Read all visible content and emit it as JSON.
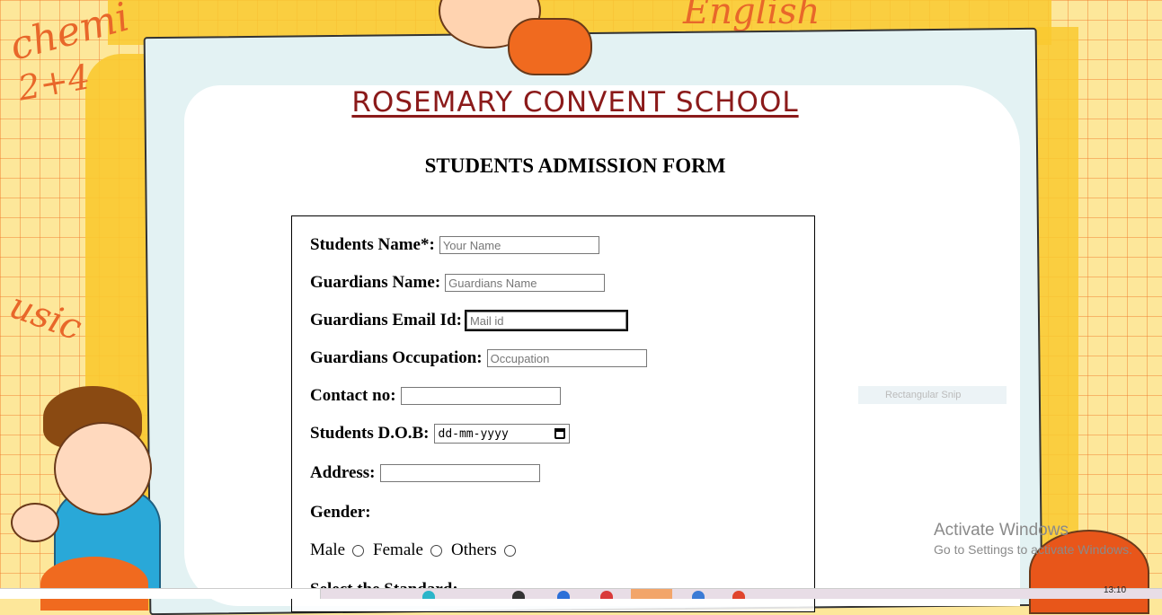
{
  "school_title": "ROSEMARY CONVENT SCHOOL",
  "form_heading": "STUDENTS ADMISSION FORM",
  "fields": {
    "student_name": {
      "label": "Students Name*:",
      "placeholder": "Your Name"
    },
    "guardian_name": {
      "label": "Guardians Name:",
      "placeholder": "Guardians Name"
    },
    "guardian_email": {
      "label": "Guardians Email Id:",
      "placeholder": "Mail id"
    },
    "guardian_occupation": {
      "label": "Guardians Occupation:",
      "placeholder": "Occupation"
    },
    "contact": {
      "label": "Contact no:",
      "placeholder": ""
    },
    "dob": {
      "label": "Students D.O.B:",
      "placeholder": "dd-mm-yyyy"
    },
    "address": {
      "label": "Address:",
      "placeholder": ""
    },
    "gender": {
      "label": "Gender:"
    }
  },
  "gender_options": [
    "Male",
    "Female",
    "Others"
  ],
  "standard_label": "Select the Standard:",
  "watermark": {
    "title": "Activate Windows",
    "subtitle": "Go to Settings to activate Windows."
  },
  "snip_text": "Rectangular Snip",
  "clock": "13:10",
  "colors": {
    "title": "#8b1a1a",
    "grid": "#f0782a",
    "paper": "#e3f2f3"
  }
}
